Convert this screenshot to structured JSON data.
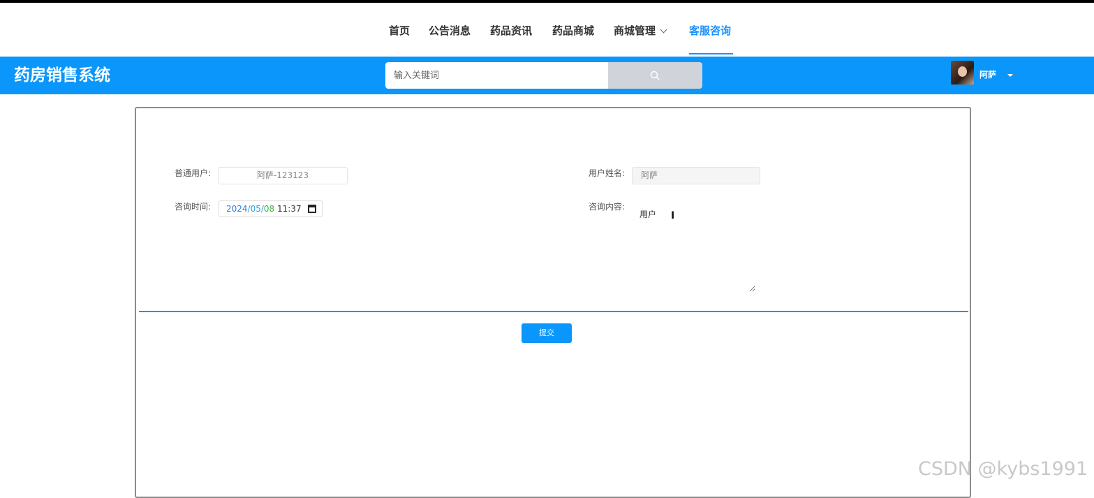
{
  "nav": {
    "items": [
      {
        "label": "首页",
        "active": false
      },
      {
        "label": "公告消息",
        "active": false
      },
      {
        "label": "药品资讯",
        "active": false
      },
      {
        "label": "药品商城",
        "active": false
      },
      {
        "label": "商城管理",
        "active": false,
        "has_dropdown": true
      },
      {
        "label": "客服咨询",
        "active": true
      }
    ]
  },
  "header": {
    "brand": "药房销售系统",
    "search_placeholder": "输入关键词",
    "search_icon": "search-icon",
    "user_name": "阿萨"
  },
  "form": {
    "user_label": "普通用户:",
    "user_value": "阿萨-123123",
    "name_label": "用户姓名:",
    "name_value": "阿萨",
    "time_label": "咨询时间:",
    "time_year": "2024",
    "time_month": "05",
    "time_day": "08",
    "time_clock": "11:37",
    "content_label": "咨询内容:",
    "content_value": "用户",
    "submit_label": "提交"
  },
  "watermark": "CSDN @kybs1991",
  "colors": {
    "accent": "#0a96fb",
    "active_nav": "#1890ff"
  }
}
